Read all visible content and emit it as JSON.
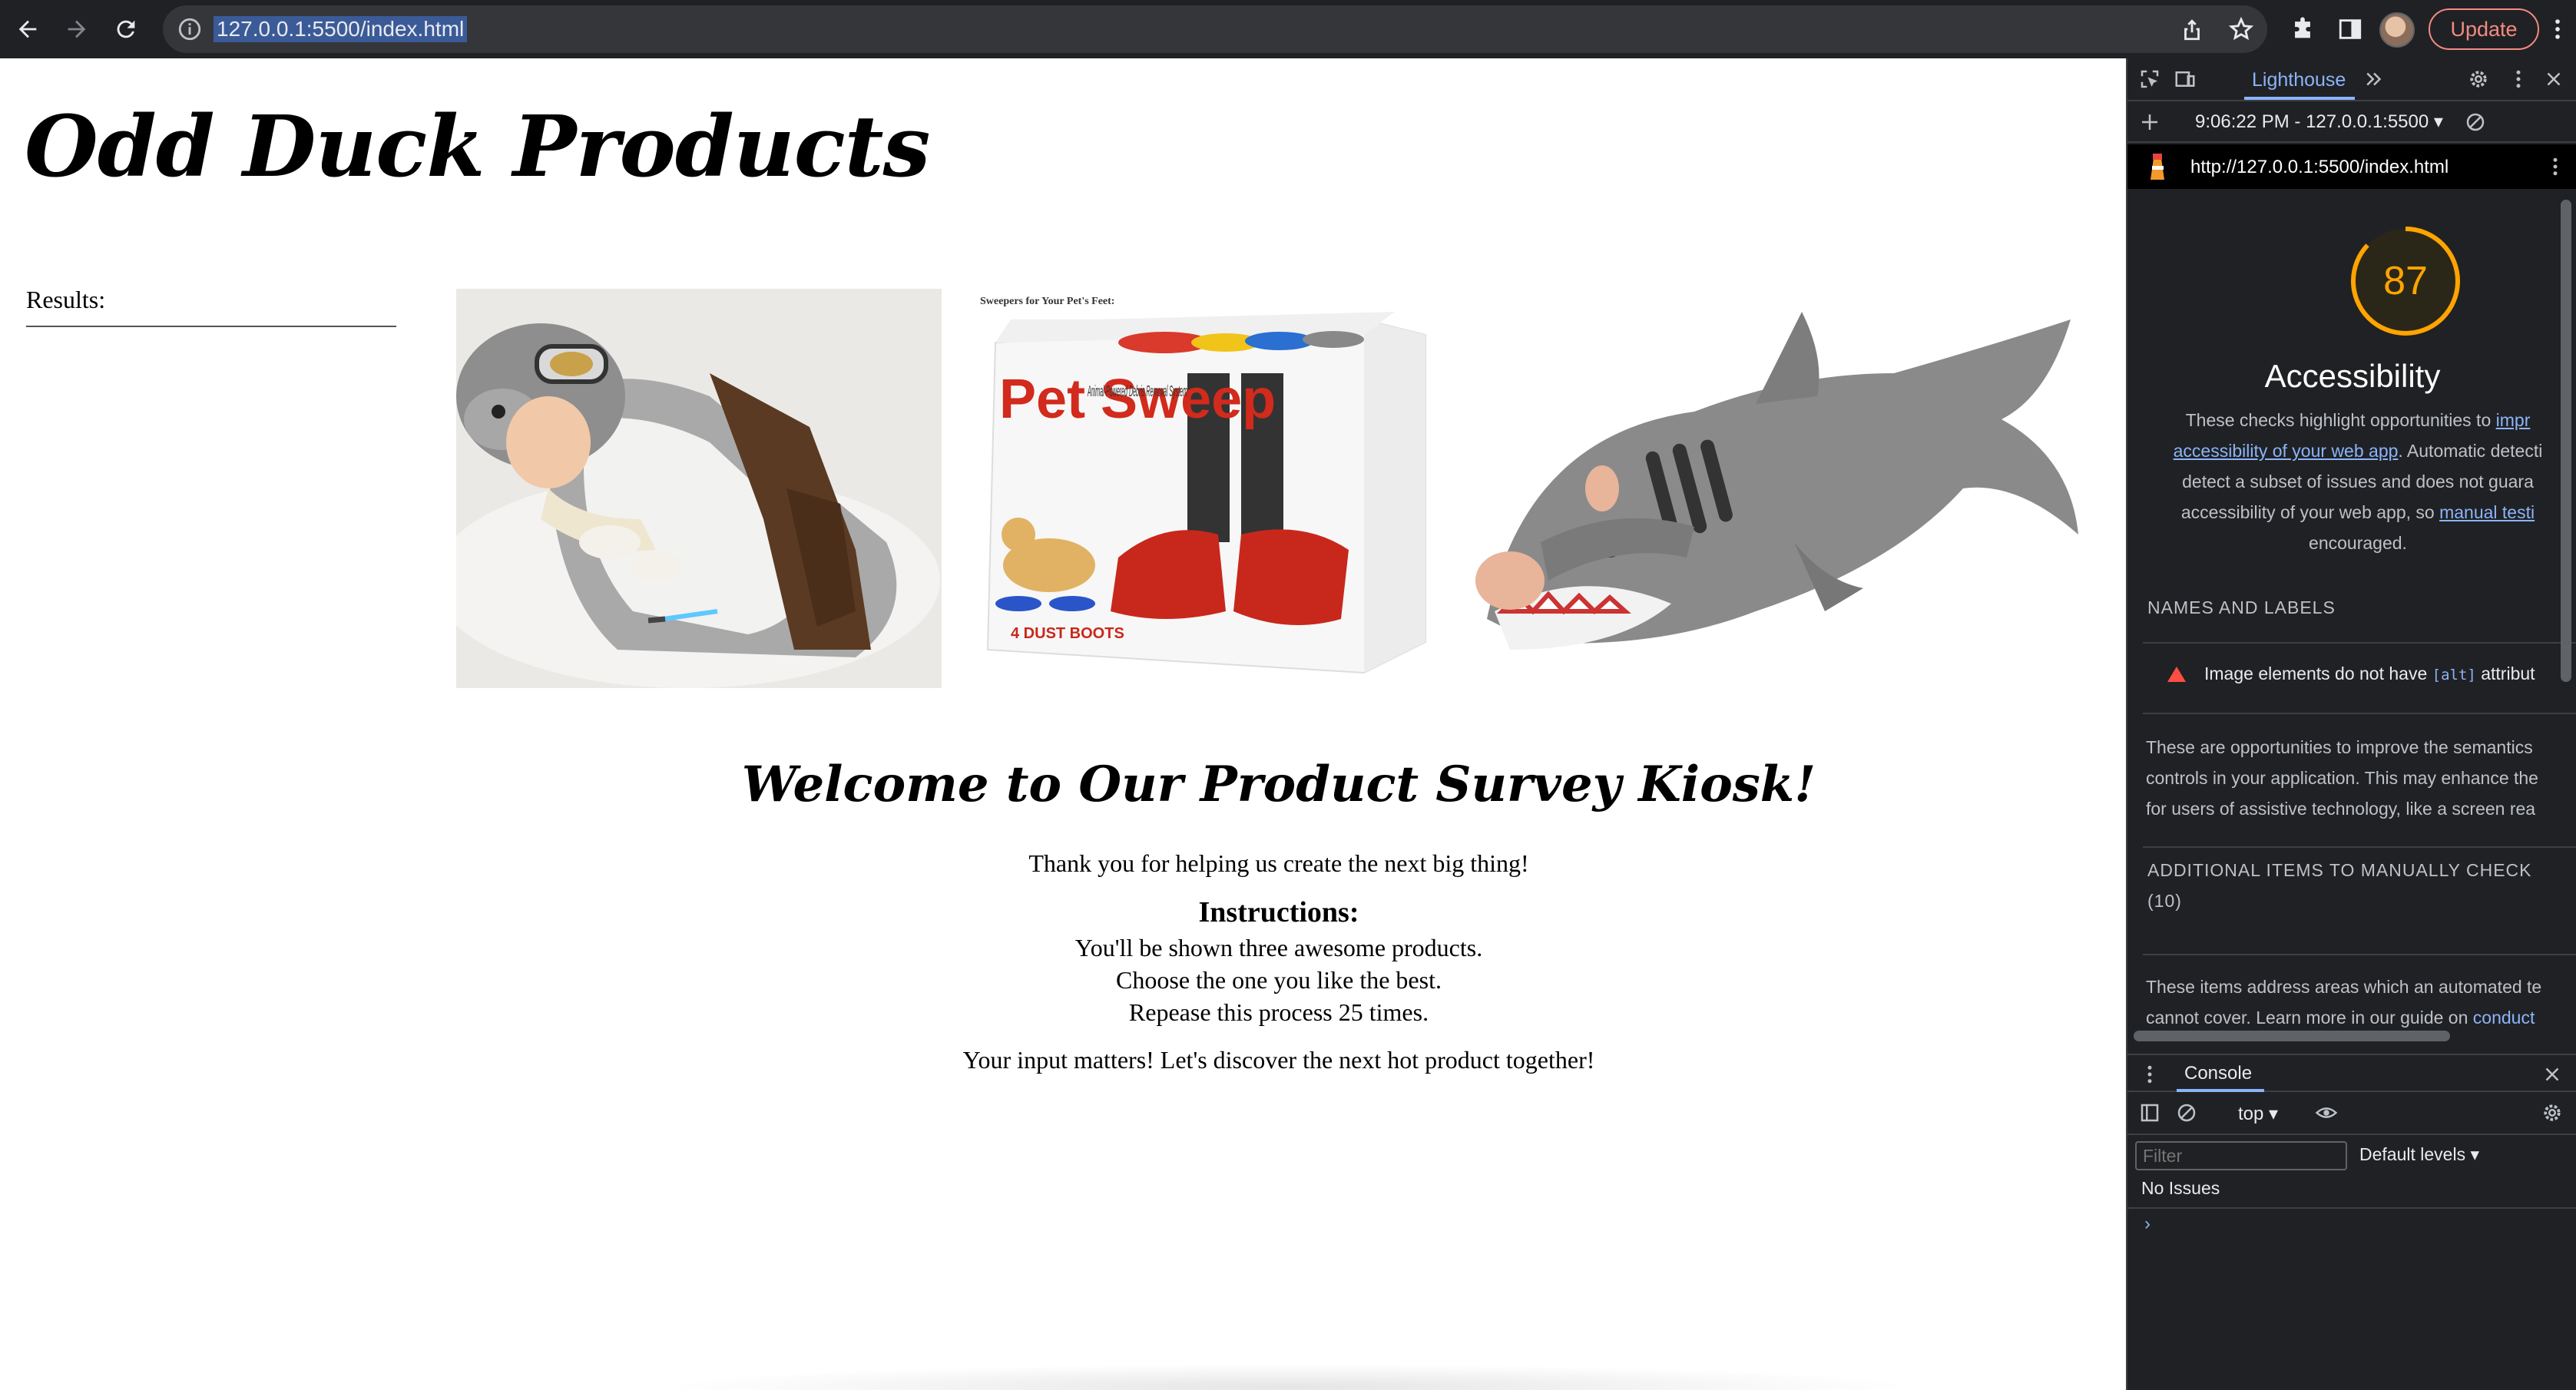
{
  "browser": {
    "url": "127.0.0.1:5500/index.html",
    "update_label": "Update"
  },
  "page": {
    "title": "Odd Duck Products",
    "results_label": "Results:",
    "products": [
      {
        "name": "tauntaun-sleeping-bag"
      },
      {
        "name": "pet-sweep-box"
      },
      {
        "name": "shark-sleeping-bag"
      }
    ],
    "pet_sweep_box": {
      "top_caption": "Sweepers for Your Pet's Feet:",
      "brand": "Pet Sweep",
      "tagline": "Animal-Powered Debris Removal System",
      "count": "4 DUST BOOTS"
    },
    "welcome_heading": "Welcome to Our Product Survey Kiosk!",
    "thank_you": "Thank you for helping us create the next big thing!",
    "instructions_heading": "Instructions:",
    "instructions": [
      "You'll be shown three awesome products.",
      "Choose the one you like the best.",
      "Repease this process 25 times."
    ],
    "closing": "Your input matters! Let's discover the next hot product together!"
  },
  "devtools": {
    "tab_label": "Lighthouse",
    "report_select": "9:06:22 PM - 127.0.0.1:5500 ▾",
    "report_url": "http://127.0.0.1:5500/index.html",
    "score": "87",
    "score_fraction": 0.87,
    "score_color": "#ffa400",
    "category": "Accessibility",
    "description_lines": [
      "These checks highlight opportunities to ",
      "impr",
      "accessibility of your web app",
      ". Automatic detecti",
      "detect a subset of issues and does not guara",
      "accessibility of your web app, so ",
      "manual testi",
      "encouraged."
    ],
    "names_labels_heading": "NAMES AND LABELS",
    "audit_prefix": "Image elements do not have ",
    "audit_code": "[alt]",
    "audit_suffix": " attribut",
    "semantics_para": [
      "These are opportunities to improve the semantics",
      "controls in your application. This may enhance the",
      "for users of assistive technology, like a screen rea"
    ],
    "manual_heading": "ADDITIONAL ITEMS TO MANUALLY CHECK",
    "manual_count": "(10)",
    "manual_para_1": "These items address areas which an automated te",
    "manual_para_2_prefix": "cannot cover. Learn more in our guide on ",
    "manual_para_2_link": "conduct",
    "console_tab": "Console",
    "context": "top ▾",
    "filter_placeholder": "Filter",
    "levels": "Default levels ▾",
    "no_issues": "No Issues",
    "prompt": "›"
  }
}
